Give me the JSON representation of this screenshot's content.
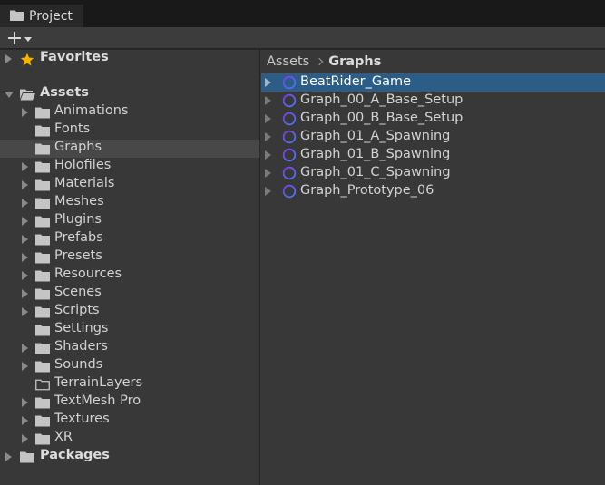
{
  "tab": {
    "title": "Project",
    "icon": "folder-icon"
  },
  "toolbar": {
    "add_icon": "plus-icon",
    "dropdown_icon": "chevron-down-icon"
  },
  "tree": {
    "favorites": {
      "label": "Favorites",
      "icon": "star-icon"
    },
    "assets": {
      "label": "Assets",
      "children": [
        {
          "label": "Animations",
          "has_children": true
        },
        {
          "label": "Fonts",
          "has_children": false
        },
        {
          "label": "Graphs",
          "has_children": false,
          "selected": true
        },
        {
          "label": "Holofiles",
          "has_children": true
        },
        {
          "label": "Materials",
          "has_children": true
        },
        {
          "label": "Meshes",
          "has_children": true
        },
        {
          "label": "Plugins",
          "has_children": true
        },
        {
          "label": "Prefabs",
          "has_children": true
        },
        {
          "label": "Presets",
          "has_children": true
        },
        {
          "label": "Resources",
          "has_children": true
        },
        {
          "label": "Scenes",
          "has_children": true
        },
        {
          "label": "Scripts",
          "has_children": true
        },
        {
          "label": "Settings",
          "has_children": false
        },
        {
          "label": "Shaders",
          "has_children": true
        },
        {
          "label": "Sounds",
          "has_children": true
        },
        {
          "label": "TerrainLayers",
          "has_children": false,
          "empty_folder": true
        },
        {
          "label": "TextMesh Pro",
          "has_children": true
        },
        {
          "label": "Textures",
          "has_children": true
        },
        {
          "label": "XR",
          "has_children": true
        }
      ]
    },
    "packages": {
      "label": "Packages"
    }
  },
  "breadcrumb": {
    "root": "Assets",
    "current": "Graphs"
  },
  "assets_list": [
    {
      "name": "BeatRider_Game",
      "selected": true
    },
    {
      "name": "Graph_00_A_Base_Setup"
    },
    {
      "name": "Graph_00_B_Base_Setup"
    },
    {
      "name": "Graph_01_A_Spawning"
    },
    {
      "name": "Graph_01_B_Spawning"
    },
    {
      "name": "Graph_01_C_Spawning"
    },
    {
      "name": "Graph_Prototype_06"
    }
  ],
  "colors": {
    "selection": "#2c5d87",
    "tree_selection": "#484848",
    "graph_icon_start": "#7d3cf0",
    "graph_icon_end": "#4a7af0",
    "star": "#f4b400",
    "folder": "#c4c4c4"
  }
}
